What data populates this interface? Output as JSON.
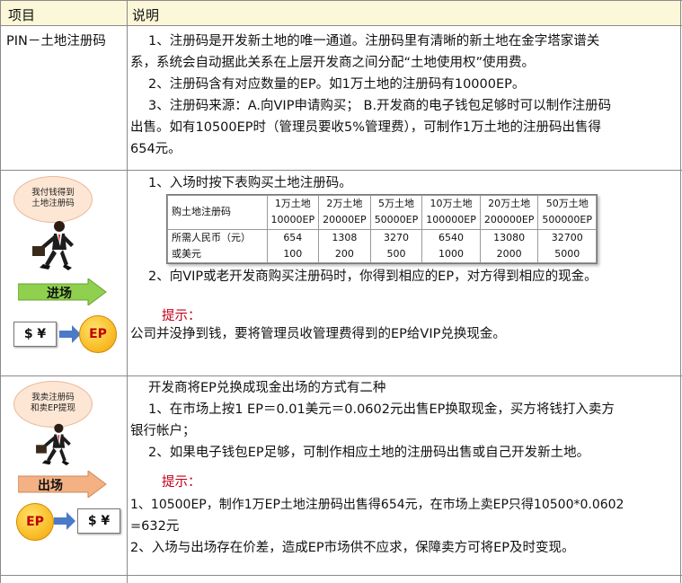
{
  "header": {
    "col1": "项目",
    "col2": "说明"
  },
  "rows": [
    {
      "label": "PIN－土地注册码",
      "lines": [
        "1、注册码是开发新土地的唯一通道。注册码里有清晰的新土地在金字塔家谱关",
        "系，系统会自动据此关系在上层开发商之间分配“土地使用权”使用费。",
        "2、注册码含有对应数量的EP。如1万土地的注册码有10000EP。",
        "3、注册码来源：A.向VIP申请购买；   B.开发商的电子钱包足够时可以制作注册码",
        "出售。如有10500EP时（管理员要收5%管理费），可制作1万土地的注册码出售得",
        "654元。"
      ]
    },
    {
      "bubble": [
        "我付钱得到",
        "土地注册码"
      ],
      "banner": "进场",
      "money": "$ ¥",
      "ep": "EP",
      "line1": "1、入场时按下表购买土地注册码。",
      "table": {
        "header": [
          "购土地注册码",
          "1万土地",
          "2万土地",
          "5万土地",
          "10万土地",
          "20万土地",
          "50万土地"
        ],
        "header_sub": [
          "",
          "10000EP",
          "20000EP",
          "50000EP",
          "100000EP",
          "200000EP",
          "500000EP"
        ],
        "row_label": [
          "所需人民币（元）",
          "或美元"
        ],
        "rmb": [
          "654",
          "1308",
          "3270",
          "6540",
          "13080",
          "32700"
        ],
        "usd": [
          "100",
          "200",
          "500",
          "1000",
          "2000",
          "5000"
        ]
      },
      "line2": "2、向VIP或老开发商购买注册码时，你得到相应的EP，对方得到相应的现金。",
      "hint": "提示：",
      "line3": "公司并没挣到钱，要将管理员收管理费得到的EP给VIP兑换现金。"
    },
    {
      "bubble": [
        "我卖注册码",
        "和卖EP提现"
      ],
      "banner": "出场",
      "money": "$ ¥",
      "ep": "EP",
      "lines": [
        "开发商将EP兑换成现金出场的方式有二种",
        "1、在市场上按1 EP＝0.01美元＝0.0602元出售EP换取现金，买方将钱打入卖方",
        "银行帐户；",
        "2、如果电子钱包EP足够，可制作相应土地的注册码出售或自己开发新土地。"
      ],
      "hint": "提示：",
      "tips": [
        "1、10500EP，制作1万EP土地注册码出售得654元，在市场上卖EP只得10500*0.0602",
        "=632元",
        "2、入场与出场存在价差，造成EP市场供不应求，保障卖方可将EP及时变现。"
      ]
    }
  ],
  "colors": {
    "header_bg": "#fbf7d8",
    "hint": "#c4001a",
    "banner": "#8fd14f",
    "banner_exit": "#f4b183",
    "bubble": "#fde6d4"
  }
}
